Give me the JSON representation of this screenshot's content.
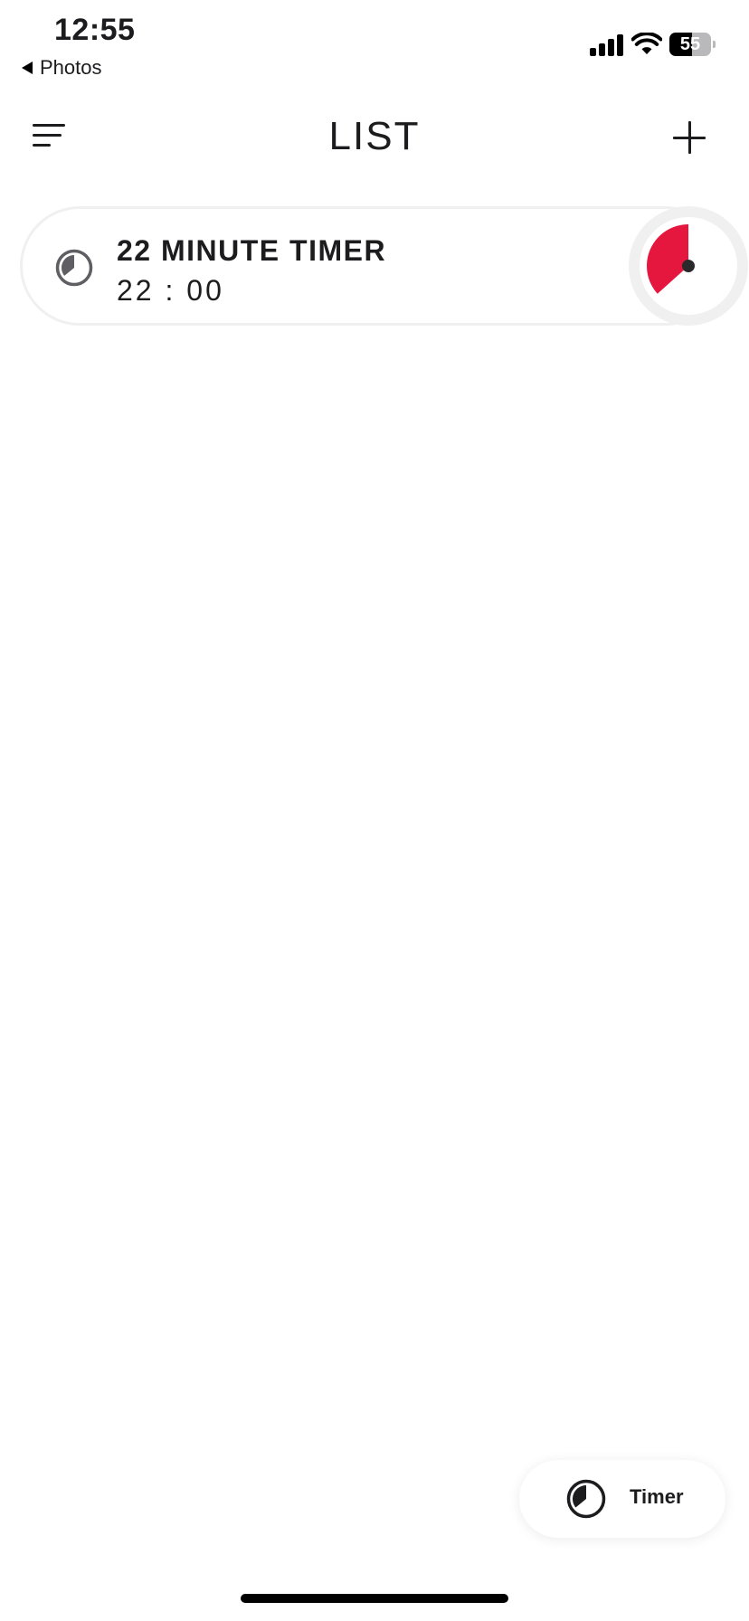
{
  "status_bar": {
    "time": "12:55",
    "back_label": "Photos",
    "battery_level": "55"
  },
  "nav": {
    "title": "LIST",
    "menu_icon": "hamburger-menu-icon",
    "add_icon": "plus-icon"
  },
  "timers": [
    {
      "name": "22 MINUTE TIMER",
      "duration": "22 : 00",
      "icon": "clock-icon",
      "dial_minutes": 22,
      "dial_color": "#e5173f"
    }
  ],
  "fab": {
    "label": "Timer",
    "icon": "clock-icon"
  },
  "colors": {
    "accent": "#e5173f",
    "text": "#1c1c1e",
    "card_border": "#f0f0f0"
  }
}
